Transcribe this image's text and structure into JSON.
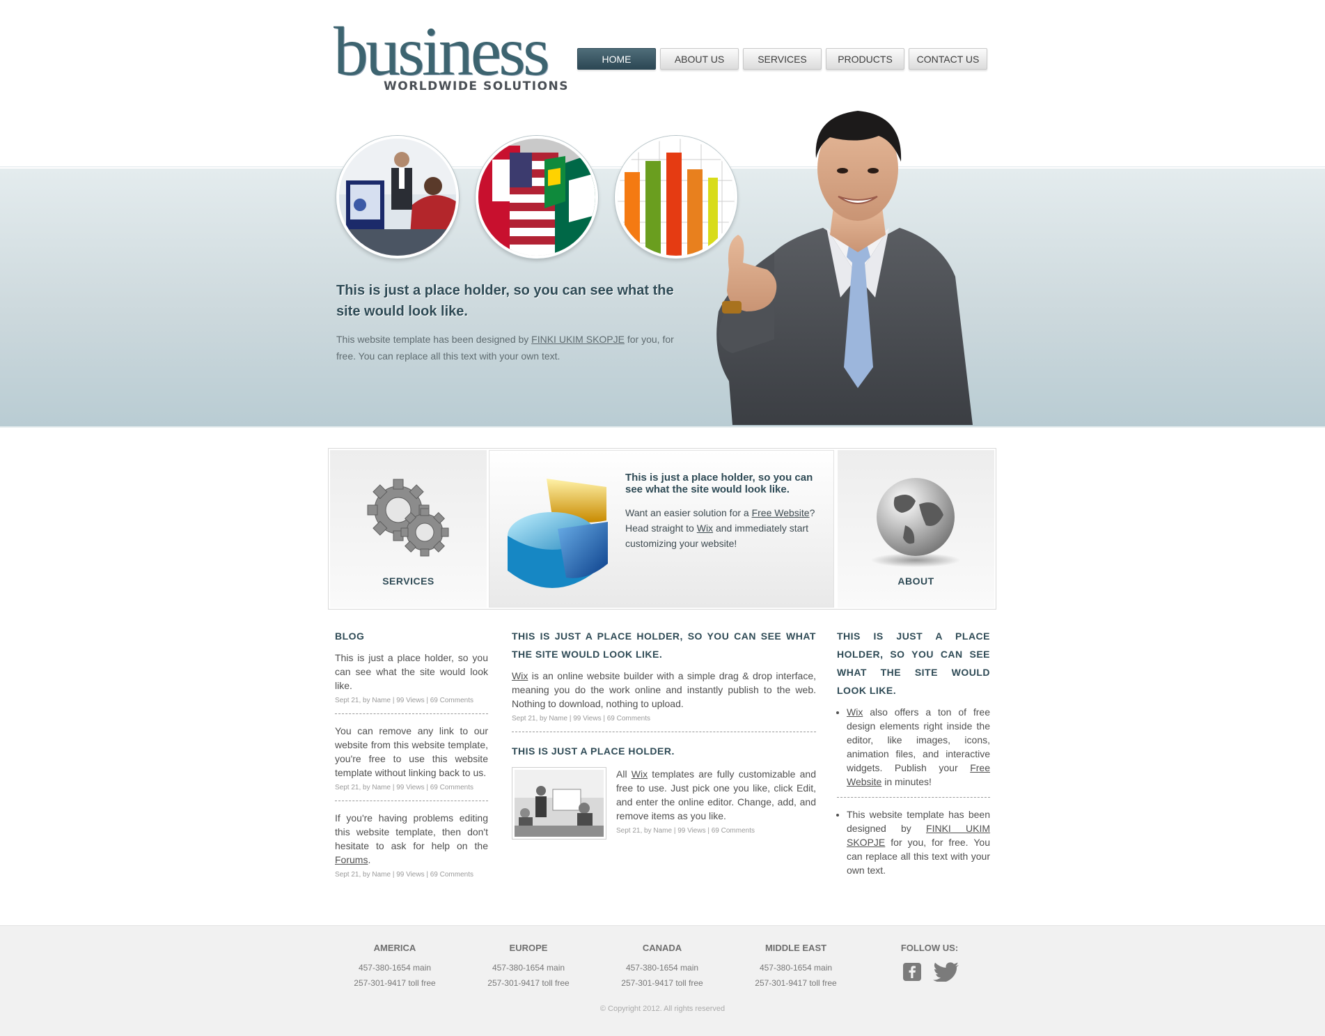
{
  "logo": {
    "word": "business",
    "sub": "WORLDWIDE SOLUTIONS"
  },
  "nav": [
    {
      "label": "HOME"
    },
    {
      "label": "ABOUT US"
    },
    {
      "label": "SERVICES"
    },
    {
      "label": "PRODUCTS"
    },
    {
      "label": "CONTACT US"
    }
  ],
  "hero": {
    "title": "This is just a place holder, so you can see what the site would look like.",
    "text_before": "This website template has been designed by ",
    "link": "FINKI UKIM SKOPJE",
    "text_after": " for you, for free. You can replace all this text with your own text."
  },
  "features": {
    "services_label": "SERVICES",
    "about_label": "ABOUT",
    "title": "This is just a place holder, so you can see what the site would look like.",
    "t1": "Want an easier solution for a ",
    "link1": "Free Website",
    "t2": "? Head straight to ",
    "link2": "Wix",
    "t3": " and immediately start customizing your website!"
  },
  "blog": {
    "heading": "BLOG",
    "posts": [
      {
        "text": "This is just a place holder, so you can see what the site would look like.",
        "meta": "Sept 21, by Name | 99 Views | 69 Comments"
      },
      {
        "text": "You can remove any link to our website from this website template, you're free to use this website template without linking back to us.",
        "meta": "Sept 21, by Name | 99 Views | 69 Comments"
      },
      {
        "text_before": "If you're having problems editing this website template, then don't hesitate to ask for help on the ",
        "link": "Forums",
        "text_after": ".",
        "meta": "Sept 21, by Name | 99 Views | 69 Comments"
      }
    ]
  },
  "middle": {
    "heading": "THIS IS JUST A PLACE HOLDER, SO YOU CAN SEE WHAT THE SITE WOULD LOOK LIKE.",
    "link": "Wix",
    "text": " is an online website builder with a simple drag & drop interface, meaning you do the work online and instantly publish to the web. Nothing to download, nothing to upload.",
    "meta": "Sept 21, by Name | 99 Views | 69 Comments",
    "heading2": "THIS IS JUST A PLACE HOLDER.",
    "text2_before": "All ",
    "text2_link": "Wix",
    "text2_after": " templates are fully customizable and free to use. Just pick one you like, click Edit, and enter the online editor. Change, add, and remove items as you like.",
    "meta2": "Sept 21, by Name | 99 Views | 69 Comments"
  },
  "right": {
    "heading": "THIS IS JUST A PLACE HOLDER, SO YOU CAN SEE WHAT THE SITE WOULD LOOK LIKE.",
    "b1_link": "Wix",
    "b1_text": " also offers a ton of free design elements right inside the editor, like images, icons, animation files, and interactive widgets. Publish your ",
    "b1_link2": "Free Website",
    "b1_after": " in minutes!",
    "b2_before": "This website template has been designed by ",
    "b2_link": "FINKI UKIM SKOPJE",
    "b2_after": " for you, for free. You can replace all this text with your own text."
  },
  "footer": {
    "regions": [
      {
        "name": "AMERICA",
        "main": "457-380-1654 main",
        "toll": "257-301-9417 toll free"
      },
      {
        "name": "EUROPE",
        "main": "457-380-1654 main",
        "toll": "257-301-9417 toll free"
      },
      {
        "name": "CANADA",
        "main": "457-380-1654 main",
        "toll": "257-301-9417 toll free"
      },
      {
        "name": "MIDDLE EAST",
        "main": "457-380-1654 main",
        "toll": "257-301-9417 toll free"
      }
    ],
    "follow": "FOLLOW US:",
    "copyright": "© Copyright 2012. All rights reserved"
  },
  "icons": [
    "facebook-icon",
    "twitter-icon",
    "gears-icon",
    "pie-chart-icon",
    "globe-icon"
  ]
}
